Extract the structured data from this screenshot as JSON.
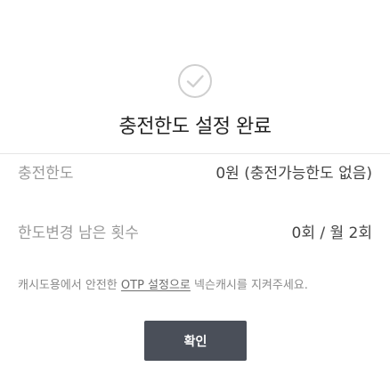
{
  "dialog": {
    "title": "충전한도 설정 완료",
    "rows": [
      {
        "label": "충전한도",
        "value": "0원 (충전가능한도 없음)"
      },
      {
        "label": "한도변경 남은 횟수",
        "value": "0회 / 월 2회"
      }
    ],
    "notice": {
      "before": "캐시도용에서 안전한 ",
      "link": "OTP 설정으로",
      "after": " 넥슨캐시를 지켜주세요."
    },
    "confirm_label": "확인"
  },
  "icons": {
    "status": "check-circle-icon"
  },
  "colors": {
    "title_text": "#222222",
    "label_text": "#9a9a9a",
    "value_text": "#444444",
    "notice_text": "#8a8a8a",
    "button_bg": "#4a4f59",
    "button_text": "#ffffff",
    "icon_stroke": "#cfcfcf"
  }
}
